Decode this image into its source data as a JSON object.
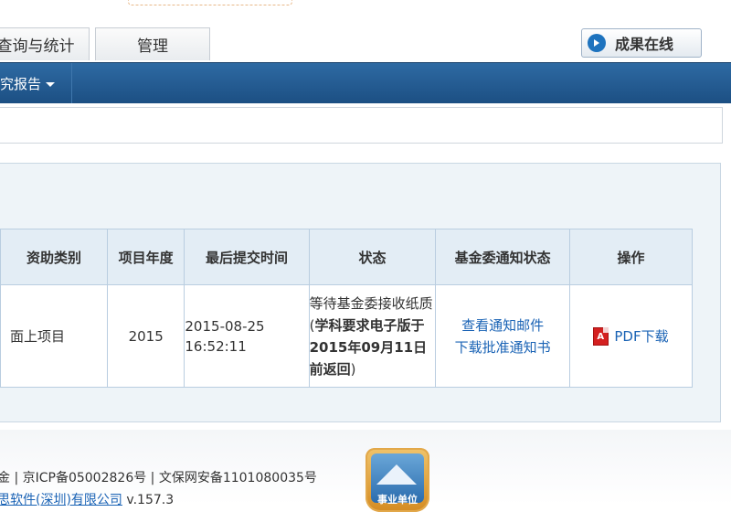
{
  "tabs": [
    {
      "label": "查询与统计"
    },
    {
      "label": "管理"
    }
  ],
  "header": {
    "results_online_label": "成果在线"
  },
  "navbar": {
    "item_label": "究报告"
  },
  "table": {
    "headers": [
      "资助类别",
      "项目年度",
      "最后提交时间",
      "状态",
      "基金委通知状态",
      "操作"
    ],
    "row": {
      "category": "面上项目",
      "year": "2015",
      "submit_date": "2015-08-25",
      "submit_time": "16:52:11",
      "status_prefix": "等待基金委接收纸质 (",
      "status_bold": "学科要求电子版于2015年09月11日前返回",
      "status_suffix": ")",
      "notice_link_1": "查看通知邮件",
      "notice_link_2": "下载批准通知书",
      "action_pdf": "PDF下载"
    }
  },
  "footer": {
    "line1": "金 | 京ICP备05002826号 | 文保网安备1101080035号",
    "line2_link": "思软件(深圳)有限公司",
    "line2_version": " v.157.3",
    "badge_label": "事业单位"
  },
  "colors": {
    "nav_bg": "#1c4f83",
    "link": "#1a63b5",
    "pdf_red": "#d42020"
  }
}
